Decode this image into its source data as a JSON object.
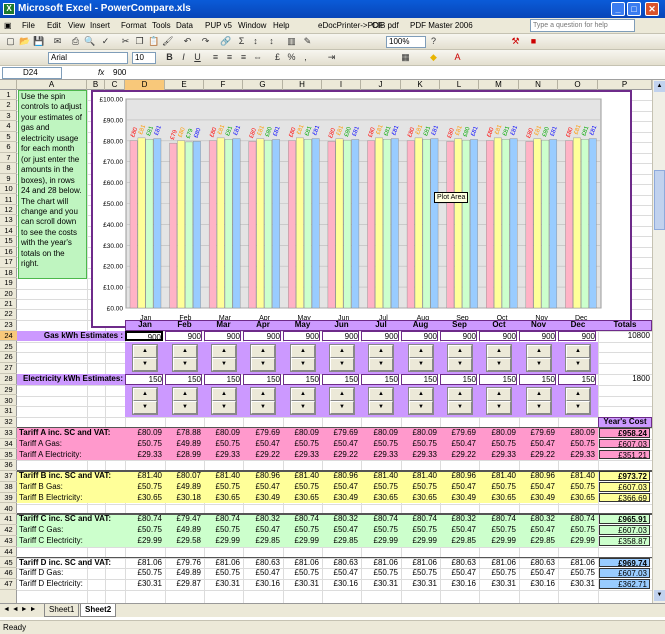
{
  "window": {
    "title": "Microsoft Excel - PowerCompare.xls",
    "help_placeholder": "Type a question for help"
  },
  "menu": [
    "File",
    "Edit",
    "View",
    "Insert",
    "Format",
    "Tools",
    "Data",
    "PUP v5",
    "Window",
    "Help",
    "eDocPrinter->PDF",
    "CIB pdf",
    "PDF Master 2006"
  ],
  "toolbar": {
    "zoom": "100%",
    "font_name": "Arial",
    "font_size": "10"
  },
  "formula_bar": {
    "name_box": "D24",
    "fx": "fx",
    "value": "900"
  },
  "columns": [
    "A",
    "B",
    "C",
    "D",
    "E",
    "F",
    "G",
    "H",
    "I",
    "J",
    "K",
    "L",
    "M",
    "N",
    "O",
    "P"
  ],
  "rows": [
    "1",
    "2",
    "3",
    "4",
    "5",
    "6",
    "7",
    "8",
    "9",
    "10",
    "11",
    "12",
    "13",
    "14",
    "15",
    "16",
    "17",
    "18",
    "19",
    "20",
    "21",
    "22",
    "23",
    "24",
    "25",
    "26",
    "27",
    "28",
    "29",
    "30",
    "31",
    "32",
    "33",
    "34",
    "35",
    "36",
    "37",
    "38",
    "39",
    "40",
    "41",
    "42",
    "43",
    "44",
    "45",
    "46",
    "47"
  ],
  "note": "Use the spin controls to adjust your estimates of gas and electricity usage for each month (or just enter the amounts in the boxes), in rows 24 and 28 below. The chart will change and you can scroll down to see the costs with the year's totals on the right.",
  "chart_data": {
    "type": "bar",
    "categories": [
      "Jan",
      "Feb",
      "Mar",
      "Apr",
      "May",
      "Jun",
      "Jul",
      "Aug",
      "Sep",
      "Oct",
      "Nov",
      "Dec"
    ],
    "ylim": [
      0,
      100
    ],
    "yticks": [
      "£0.00",
      "£10.00",
      "£20.00",
      "£30.00",
      "£40.00",
      "£50.00",
      "£60.00",
      "£70.00",
      "£80.00",
      "£90.00",
      "£100.00"
    ],
    "series": [
      {
        "color": "#ffb3c6",
        "values": [
          80.09,
          78.88,
          80.09,
          79.69,
          80.09,
          79.69,
          80.09,
          80.09,
          79.69,
          80.09,
          79.69,
          80.09
        ],
        "labels": [
          "£80",
          "£79",
          "£80",
          "£80",
          "£80",
          "£80",
          "£80",
          "£80",
          "£80",
          "£80",
          "£80",
          "£80"
        ]
      },
      {
        "color": "#ffff99",
        "values": [
          81.4,
          80.07,
          81.4,
          80.96,
          81.4,
          80.96,
          81.4,
          81.4,
          80.96,
          81.4,
          80.96,
          81.4
        ],
        "labels": [
          "£81",
          "£80",
          "£81",
          "£81",
          "£81",
          "£81",
          "£81",
          "£81",
          "£81",
          "£81",
          "£81",
          "£81"
        ]
      },
      {
        "color": "#ccffcc",
        "values": [
          80.74,
          79.47,
          80.74,
          80.32,
          80.74,
          80.32,
          80.74,
          80.74,
          80.32,
          80.74,
          80.32,
          80.74
        ],
        "labels": [
          "£81",
          "£79",
          "£81",
          "£80",
          "£81",
          "£80",
          "£81",
          "£81",
          "£80",
          "£81",
          "£80",
          "£81"
        ]
      },
      {
        "color": "#99ccff",
        "values": [
          81.06,
          79.76,
          81.06,
          80.63,
          81.06,
          80.63,
          81.06,
          81.06,
          80.63,
          81.06,
          80.63,
          81.06
        ],
        "labels": [
          "£81",
          "£80",
          "£81",
          "£81",
          "£81",
          "£81",
          "£81",
          "£81",
          "£81",
          "£81",
          "£81",
          "£81"
        ]
      }
    ],
    "label_colors": [
      "#ff0000",
      "#ff9900",
      "#00aa00",
      "#0000ff"
    ],
    "tooltip": "Plot Area"
  },
  "months": [
    "Jan",
    "Feb",
    "Mar",
    "Apr",
    "May",
    "Jun",
    "Jul",
    "Aug",
    "Sep",
    "Oct",
    "Nov",
    "Dec"
  ],
  "totals_header": "Totals",
  "gas_label": "Gas kWh Estimates :",
  "gas_values": [
    "900",
    "900",
    "900",
    "900",
    "900",
    "900",
    "900",
    "900",
    "900",
    "900",
    "900",
    "900"
  ],
  "gas_total": "10800",
  "elec_label": "Electricity kWh Estimates:",
  "elec_values": [
    "150",
    "150",
    "150",
    "150",
    "150",
    "150",
    "150",
    "150",
    "150",
    "150",
    "150",
    "150"
  ],
  "elec_total": "1800",
  "years_cost_header": "Year's Cost",
  "tariffs": [
    {
      "bg": "#ff99cc",
      "rows": [
        {
          "label": "Tariff A inc. SC and VAT:",
          "bold": true,
          "vals": [
            "£80.09",
            "£78.88",
            "£80.09",
            "£79.69",
            "£80.09",
            "£79.69",
            "£80.09",
            "£80.09",
            "£79.69",
            "£80.09",
            "£79.69",
            "£80.09"
          ],
          "total": "£958.24"
        },
        {
          "label": "Tariff A Gas:",
          "vals": [
            "£50.75",
            "£49.89",
            "£50.75",
            "£50.47",
            "£50.75",
            "£50.47",
            "£50.75",
            "£50.75",
            "£50.47",
            "£50.75",
            "£50.47",
            "£50.75"
          ],
          "total": "£607.03"
        },
        {
          "label": "Tariff A Electricity:",
          "vals": [
            "£29.33",
            "£28.99",
            "£29.33",
            "£29.22",
            "£29.33",
            "£29.22",
            "£29.33",
            "£29.33",
            "£29.22",
            "£29.33",
            "£29.22",
            "£29.33"
          ],
          "total": "£351.21"
        }
      ]
    },
    {
      "bg": "#ffff99",
      "rows": [
        {
          "label": "Tariff B inc. SC and VAT:",
          "bold": true,
          "vals": [
            "£81.40",
            "£80.07",
            "£81.40",
            "£80.96",
            "£81.40",
            "£80.96",
            "£81.40",
            "£81.40",
            "£80.96",
            "£81.40",
            "£80.96",
            "£81.40"
          ],
          "total": "£973.72"
        },
        {
          "label": "Tariff B Gas:",
          "vals": [
            "£50.75",
            "£49.89",
            "£50.75",
            "£50.47",
            "£50.75",
            "£50.47",
            "£50.75",
            "£50.75",
            "£50.47",
            "£50.75",
            "£50.47",
            "£50.75"
          ],
          "total": "£607.03"
        },
        {
          "label": "Tariff B Electricity:",
          "vals": [
            "£30.65",
            "£30.18",
            "£30.65",
            "£30.49",
            "£30.65",
            "£30.49",
            "£30.65",
            "£30.65",
            "£30.49",
            "£30.65",
            "£30.49",
            "£30.65"
          ],
          "total": "£366.69"
        }
      ]
    },
    {
      "bg": "#ccffcc",
      "rows": [
        {
          "label": "Tariff C inc. SC and VAT:",
          "bold": true,
          "vals": [
            "£80.74",
            "£79.47",
            "£80.74",
            "£80.32",
            "£80.74",
            "£80.32",
            "£80.74",
            "£80.74",
            "£80.32",
            "£80.74",
            "£80.32",
            "£80.74"
          ],
          "total": "£965.91"
        },
        {
          "label": "Tariff C Gas:",
          "vals": [
            "£50.75",
            "£49.89",
            "£50.75",
            "£50.47",
            "£50.75",
            "£50.47",
            "£50.75",
            "£50.75",
            "£50.47",
            "£50.75",
            "£50.47",
            "£50.75"
          ],
          "total": "£607.03"
        },
        {
          "label": "Tariff C Electricity:",
          "vals": [
            "£29.99",
            "£29.58",
            "£29.99",
            "£29.85",
            "£29.99",
            "£29.85",
            "£29.99",
            "£29.99",
            "£29.85",
            "£29.99",
            "£29.85",
            "£29.99"
          ],
          "total": "£358.87"
        }
      ]
    },
    {
      "bg": "#99ccff",
      "rows": [
        {
          "label": "Tariff D inc. SC and VAT:",
          "bold": true,
          "vals": [
            "£81.06",
            "£79.76",
            "£81.06",
            "£80.63",
            "£81.06",
            "£80.63",
            "£81.06",
            "£81.06",
            "£80.63",
            "£81.06",
            "£80.63",
            "£81.06"
          ],
          "total": "£969.74"
        },
        {
          "label": "Tariff D Gas:",
          "vals": [
            "£50.75",
            "£49.89",
            "£50.75",
            "£50.47",
            "£50.75",
            "£50.47",
            "£50.75",
            "£50.75",
            "£50.47",
            "£50.75",
            "£50.47",
            "£50.75"
          ],
          "total": "£607.03"
        },
        {
          "label": "Tariff D Electricity:",
          "vals": [
            "£30.31",
            "£29.87",
            "£30.31",
            "£30.16",
            "£30.31",
            "£30.16",
            "£30.31",
            "£30.31",
            "£30.16",
            "£30.31",
            "£30.16",
            "£30.31"
          ],
          "total": "£362.71"
        }
      ]
    }
  ],
  "sheets": [
    "Sheet1",
    "Sheet2"
  ],
  "active_sheet": "Sheet2",
  "status": "Ready"
}
